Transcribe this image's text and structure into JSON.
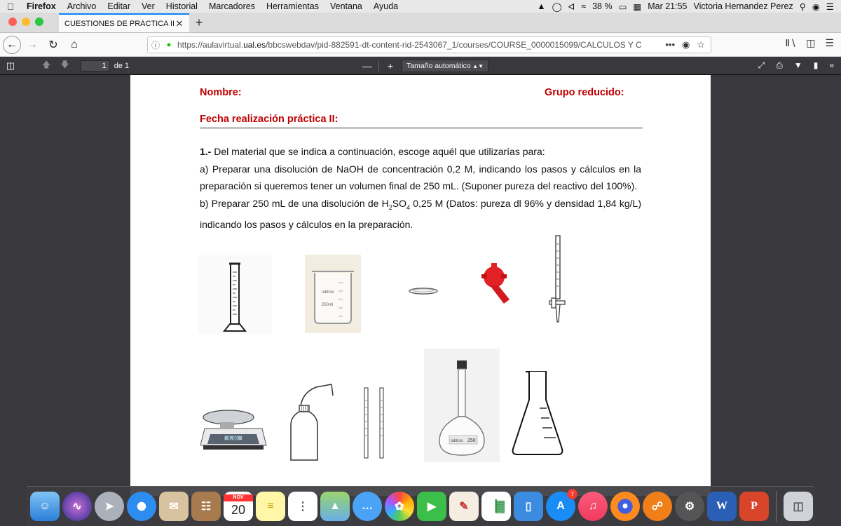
{
  "menubar": {
    "app_name": "Firefox",
    "items": [
      "Archivo",
      "Editar",
      "Ver",
      "Historial",
      "Marcadores",
      "Herramientas",
      "Ventana",
      "Ayuda"
    ],
    "battery": "38 %",
    "clock": "Mar 21:55",
    "user": "Victoria Hernandez Perez"
  },
  "tab": {
    "title": "CUESTIONES DE PRÁCTICA II: PREP"
  },
  "address": {
    "url_prefix": "https://aulavirtual.",
    "url_domain": "ual.es",
    "url_path": "/bbcswebdav/pid-882591-dt-content-rid-2543067_1/courses/COURSE_0000015099/CALCULOS Y C"
  },
  "pdf": {
    "page_number": "1",
    "page_of": "de 1",
    "zoom_label": "Tamaño automático"
  },
  "document": {
    "nombre": "Nombre:",
    "grupo": "Grupo reducido:",
    "fecha": "Fecha realización práctica II:",
    "q1_num": "1.-",
    "q1_intro": " Del material que se indica a continuación, escoge aquél que utilizarías para:",
    "q1_a": "a) Preparar una disolución de NaOH de concentración 0,2 M, indicando los pasos y cálculos en la preparación si queremos tener un volumen final de 250 mL. (Suponer pureza del reactivo del 100%).",
    "q1_b_pre": "b) Preparar 250 mL de una disolución de H",
    "q1_b_sub1": "2",
    "q1_b_mid": "SO",
    "q1_b_sub2": "4",
    "q1_b_post": " 0,25 M (Datos: pureza dl 96% y densidad 1,84 kg/L) indicando los pasos y cálculos en la preparación.",
    "beaker_brand": "labbox",
    "beaker_volume": "250ml",
    "flask_label": "labbox",
    "flask_volume": "250",
    "balance_readout": "0.00"
  },
  "dock": {
    "calendar_month": "NOV",
    "calendar_day": "20",
    "appstore_badge": "7"
  }
}
